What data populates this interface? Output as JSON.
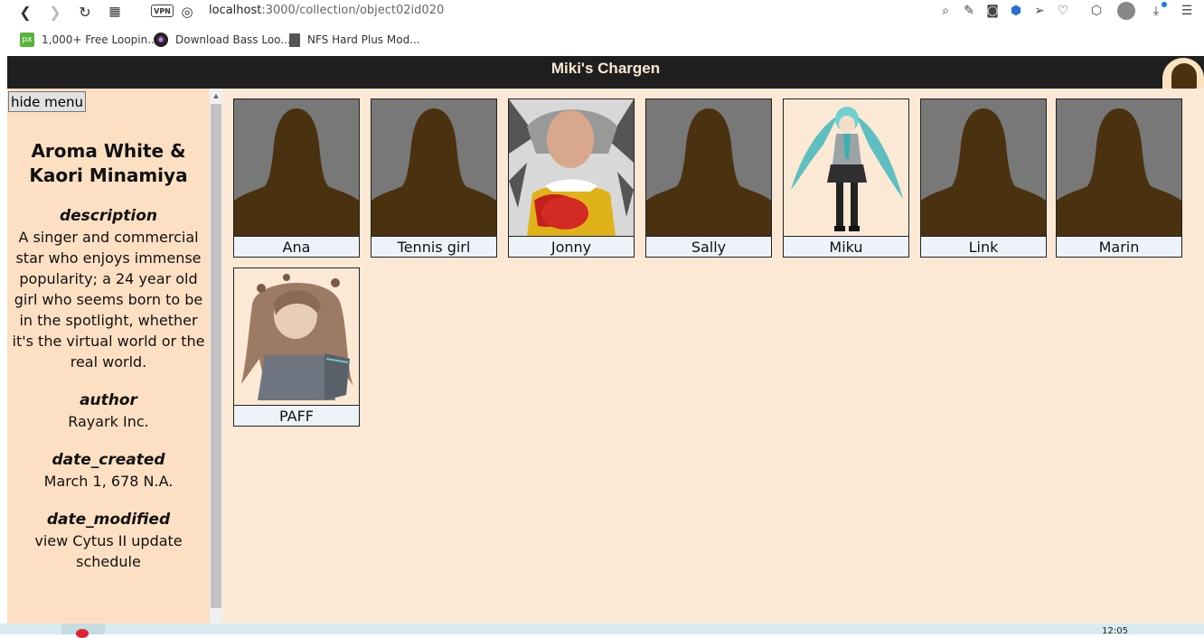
{
  "browser": {
    "url_host": "localhost",
    "url_path": ":3000/collection/object02id020",
    "vpn_label": "VPN",
    "bookmarks": [
      {
        "label": "1,000+ Free Loopin...",
        "icon": "px-icon",
        "icon_text": "px"
      },
      {
        "label": "Download Bass Loo...",
        "icon": "waveform-icon",
        "icon_text": "◉"
      },
      {
        "label": "NFS Hard Plus Mod...",
        "icon": "document-icon",
        "icon_text": ""
      }
    ]
  },
  "header": {
    "title": "Miki's Chargen"
  },
  "sidebar": {
    "hide_label": "hide menu",
    "title": "Aroma White & Kaori Minamiya",
    "fields": [
      {
        "label": "description",
        "value": "A singer and commercial star who enjoys immense popularity; a 24 year old girl who seems born to be in the spotlight, whether it's the virtual world or the real world."
      },
      {
        "label": "author",
        "value": "Rayark Inc."
      },
      {
        "label": "date_created",
        "value": "March 1, 678 N.A."
      },
      {
        "label": "date_modified",
        "value": "view Cytus II update schedule"
      }
    ]
  },
  "gallery": {
    "items": [
      {
        "name": "Ana",
        "image": "silhouette"
      },
      {
        "name": "Tennis girl",
        "image": "silhouette"
      },
      {
        "name": "Jonny",
        "image": "bald-hero"
      },
      {
        "name": "Sally",
        "image": "silhouette"
      },
      {
        "name": "Miku",
        "image": "twin-tails"
      },
      {
        "name": "Link",
        "image": "silhouette"
      },
      {
        "name": "Marin",
        "image": "silhouette"
      },
      {
        "name": "PAFF",
        "image": "sketch-girl"
      }
    ]
  },
  "taskbar": {
    "clock": "12:05"
  },
  "colors": {
    "header_bg": "#1f1f1f",
    "header_text": "#fbe8d3",
    "sidebar_bg": "#fde0c4",
    "main_bg": "#fbe9d6",
    "silhouette": "#4a3110",
    "card_bg": "#787878",
    "label_bg": "#eef3fb"
  }
}
